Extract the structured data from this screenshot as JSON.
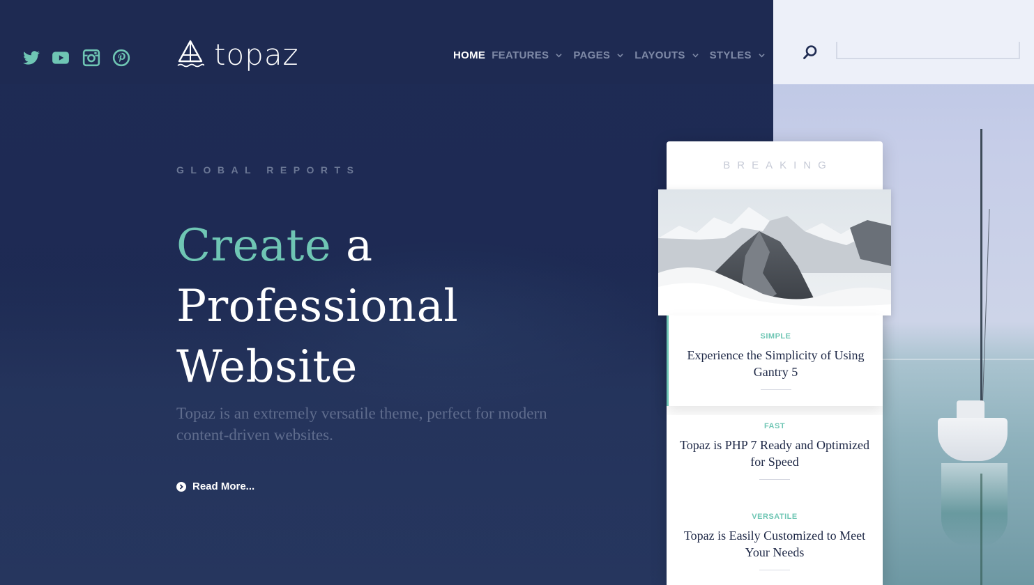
{
  "brand": {
    "name": "topaz",
    "accent_color": "#6fc6b4",
    "dark_color": "#1f2b52"
  },
  "social": [
    {
      "name": "twitter",
      "icon": "twitter-icon"
    },
    {
      "name": "youtube",
      "icon": "youtube-icon"
    },
    {
      "name": "instagram",
      "icon": "instagram-icon"
    },
    {
      "name": "pinterest",
      "icon": "pinterest-icon"
    }
  ],
  "nav": {
    "items": [
      {
        "label": "HOME",
        "active": true,
        "dropdown": false
      },
      {
        "label": "FEATURES",
        "active": false,
        "dropdown": true
      },
      {
        "label": "PAGES",
        "active": false,
        "dropdown": true
      },
      {
        "label": "LAYOUTS",
        "active": false,
        "dropdown": true
      },
      {
        "label": "STYLES",
        "active": false,
        "dropdown": true
      }
    ]
  },
  "search": {
    "icon": "search-icon",
    "value": "",
    "placeholder": ""
  },
  "hero": {
    "kicker": "GLOBAL REPORTS",
    "headline_accent": "Create",
    "headline_rest": " a Professional Website",
    "subtext": "Topaz is an extremely versatile theme, perfect for modern content-driven websites.",
    "read_more": "Read More..."
  },
  "breaking": {
    "title": "BREAKING",
    "items": [
      {
        "tag": "SIMPLE",
        "title": "Experience the Simplicity of Using Gantry 5"
      },
      {
        "tag": "FAST",
        "title": "Topaz is PHP 7 Ready and Optimized for Speed"
      },
      {
        "tag": "VERSATILE",
        "title": "Topaz is Easily Customized to Meet Your Needs"
      }
    ]
  }
}
